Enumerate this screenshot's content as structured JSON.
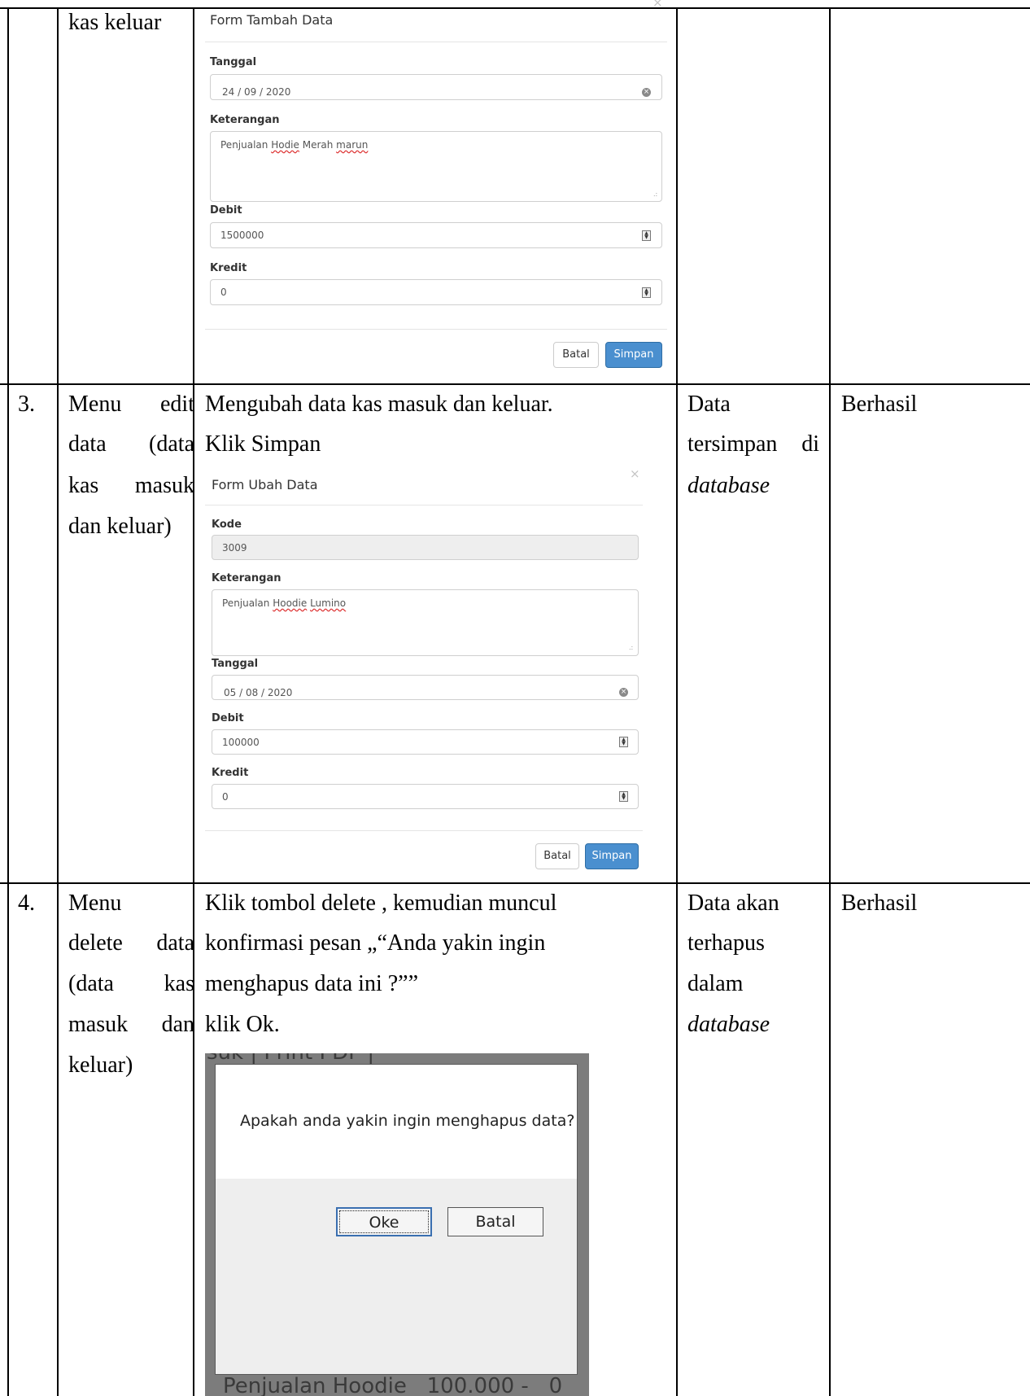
{
  "row2": {
    "scenario": "kas keluar",
    "form": {
      "title": "Form Tambah Data",
      "close": "×",
      "tanggal_label": "Tanggal",
      "tanggal_value": "24 / 09 / 2020",
      "keterangan_label": "Keterangan",
      "keterangan_prefix": "Penjualan ",
      "keterangan_word1": "Hodie",
      "keterangan_mid": " Merah ",
      "keterangan_word2": "marun",
      "debit_label": "Debit",
      "debit_value": "1500000",
      "kredit_label": "Kredit",
      "kredit_value": "0",
      "batal": "Batal",
      "simpan": "Simpan"
    }
  },
  "row3": {
    "no": "3.",
    "scenario_lines": [
      [
        "Menu",
        "edit"
      ],
      [
        "data",
        "(data"
      ],
      [
        "kas",
        "masuk"
      ]
    ],
    "scenario_last": "dan keluar)",
    "test_line1": "Mengubah data kas masuk dan keluar.",
    "test_line2": "Klik Simpan",
    "expected_line1": "Data",
    "expected_line2_a": "tersimpan",
    "expected_line2_b": "di",
    "expected_line3": "database",
    "result": "Berhasil",
    "form": {
      "title": "Form Ubah Data",
      "close": "×",
      "kode_label": "Kode",
      "kode_value": "3009",
      "keterangan_label": "Keterangan",
      "keterangan_prefix": "Penjualan ",
      "keterangan_word1": "Hoodie",
      "keterangan_mid": " ",
      "keterangan_word2": "Lumino",
      "tanggal_label": "Tanggal",
      "tanggal_value": "05 / 08 / 2020",
      "debit_label": "Debit",
      "debit_value": "100000",
      "kredit_label": "Kredit",
      "kredit_value": "0",
      "batal": "Batal",
      "simpan": "Simpan"
    }
  },
  "row4": {
    "no": "4.",
    "scenario_line1": "Menu",
    "scenario_lines": [
      [
        "delete",
        "data"
      ],
      [
        "(data",
        "kas"
      ],
      [
        "masuk",
        "dan"
      ]
    ],
    "scenario_last": "keluar)",
    "test_line1": "Klik tombol delete , kemudian muncul",
    "test_line2": "konfirmasi pesan „“Anda yakin ingin",
    "test_line3": "menghapus data ini ?””",
    "test_line4": "klik Ok.",
    "expected_line1": "Data akan",
    "expected_line2": "terhapus",
    "expected_line3": "dalam",
    "expected_line4": "database",
    "result": "Berhasil",
    "dialog": {
      "bg_top": "suk | Print PDF |",
      "bg_bottom": "Penjualan Hoodie   100.000 -   0",
      "message": "Apakah anda yakin ingin menghapus data?",
      "ok": "Oke",
      "cancel": "Batal"
    }
  }
}
